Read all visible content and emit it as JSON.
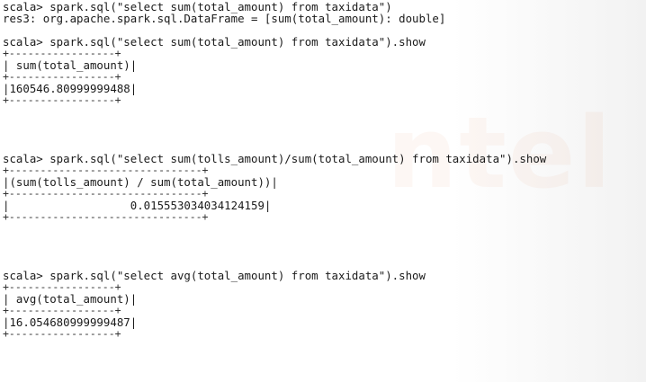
{
  "terminal": {
    "watermark": "ntel",
    "lines": [
      "scala> spark.sql(\"select sum(total_amount) from taxidata\")",
      "res3: org.apache.spark.sql.DataFrame = [sum(total_amount): double]",
      "",
      "scala> spark.sql(\"select sum(total_amount) from taxidata\").show",
      "+-----------------+",
      "| sum(total_amount)|",
      "+-----------------+",
      "|160546.80999999488|",
      "+-----------------+",
      "",
      "",
      "",
      "",
      "scala> spark.sql(\"select sum(tolls_amount)/sum(total_amount) from taxidata\").show",
      "+-------------------------------+",
      "|(sum(tolls_amount) / sum(total_amount))|",
      "+-------------------------------+",
      "|                  0.015553034034124159|",
      "+-------------------------------+",
      "",
      "",
      "",
      "",
      "scala> spark.sql(\"select avg(total_amount) from taxidata\").show",
      "+-----------------+",
      "| avg(total_amount)|",
      "+-----------------+",
      "|16.054680999999487|",
      "+-----------------+"
    ]
  }
}
